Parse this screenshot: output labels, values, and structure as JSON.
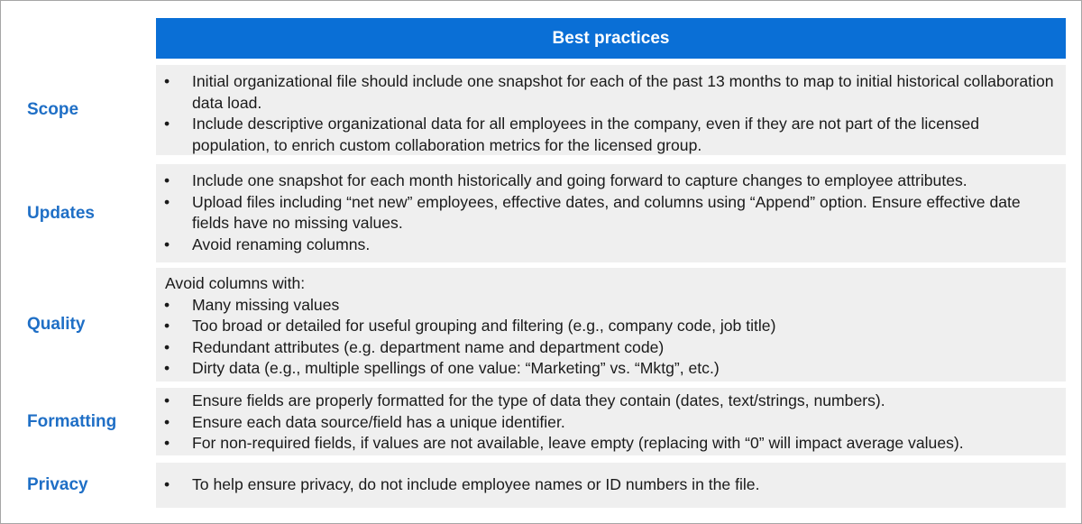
{
  "header": {
    "title": "Best practices"
  },
  "rows": [
    {
      "label": "Scope",
      "intro": "",
      "bullets": [
        "Initial organizational file should include one snapshot for each of the past 13 months to map to initial historical collaboration data load.",
        "Include descriptive organizational data for all employees in the company, even if they are not part of the licensed population, to enrich custom collaboration metrics for the licensed group."
      ]
    },
    {
      "label": "Updates",
      "intro": "",
      "bullets": [
        "Include one snapshot for each month historically and going forward to capture changes to employee attributes.",
        "Upload files including “net new” employees, effective dates, and columns using “Append” option. Ensure effective date fields have no missing values.",
        "Avoid renaming columns."
      ]
    },
    {
      "label": "Quality",
      "intro": "Avoid columns with:",
      "bullets": [
        "Many missing values",
        "Too broad or detailed for useful grouping and filtering (e.g., company code, job title)",
        "Redundant attributes (e.g. department name and department code)",
        "Dirty data (e.g., multiple spellings of one value: “Marketing” vs. “Mktg”, etc.)"
      ]
    },
    {
      "label": "Formatting",
      "intro": "",
      "bullets": [
        "Ensure fields are properly formatted for the type of data they contain (dates, text/strings, numbers).",
        "Ensure each data source/field has a unique identifier.",
        "For non-required fields, if values are not available, leave empty (replacing with “0” will impact average values)."
      ]
    },
    {
      "label": "Privacy",
      "intro": "",
      "bullets": [
        "To help ensure privacy, do not include employee names or ID numbers in the file."
      ]
    }
  ],
  "bullet_glyph": "•",
  "colors": {
    "header_bg": "#0a6fd6",
    "label_text": "#1f6fc6",
    "panel_bg": "#efefef"
  }
}
